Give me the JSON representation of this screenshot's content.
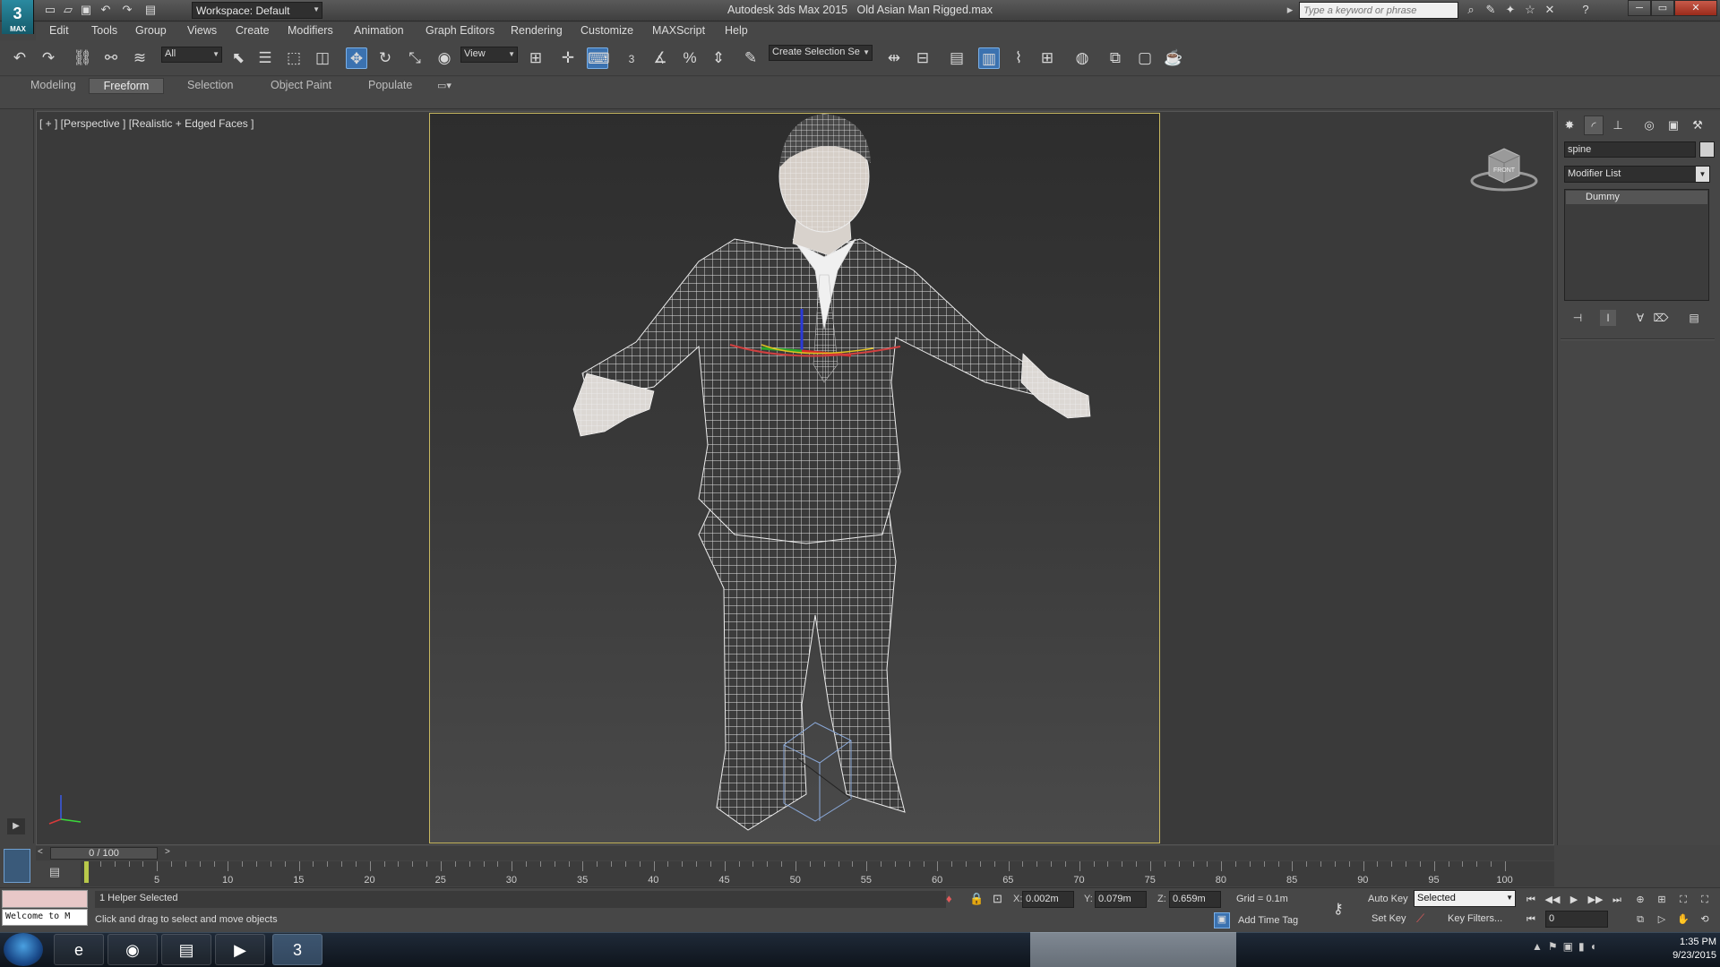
{
  "titlebar": {
    "app_name": "Autodesk 3ds Max  2015",
    "file_name": "Old Asian Man Rigged.max",
    "logo_text": "MAX",
    "workspace": "Workspace: Default",
    "search_placeholder": "Type a keyword or phrase"
  },
  "menu": [
    "Edit",
    "Tools",
    "Group",
    "Views",
    "Create",
    "Modifiers",
    "Animation",
    "Graph Editors",
    "Rendering",
    "Customize",
    "MAXScript",
    "Help"
  ],
  "toolbar": {
    "selection_filter": "All",
    "ref_coord": "View",
    "snap_label": "3",
    "named_selection": "Create Selection Se"
  },
  "ribbon": {
    "tabs": [
      "Modeling",
      "Freeform",
      "Selection",
      "Object Paint",
      "Populate"
    ],
    "active_tab": "Freeform"
  },
  "viewport": {
    "label": "[ + ] [Perspective ] [Realistic + Edged Faces ]",
    "viewcube_text": "FRONT"
  },
  "command_panel": {
    "object_name": "spine",
    "modifier_list": "Modifier List",
    "stack_item": "Dummy"
  },
  "timeline": {
    "frame_display": "0 / 100",
    "ticks": [
      5,
      10,
      15,
      20,
      25,
      30,
      35,
      40,
      45,
      50,
      55,
      60,
      65,
      70,
      75,
      80,
      85,
      90,
      95,
      100
    ]
  },
  "status": {
    "listener_text": "Welcome to M",
    "selection": "1 Helper Selected",
    "prompt": "Click and drag to select and move objects",
    "x_label": "X:",
    "x_value": "0.002m",
    "y_label": "Y:",
    "y_value": "0.079m",
    "z_label": "Z:",
    "z_value": "0.659m",
    "grid": "Grid = 0.1m",
    "add_time_tag": "Add Time Tag",
    "auto_key": "Auto Key",
    "set_key": "Set Key",
    "selected": "Selected",
    "key_filters": "Key Filters...",
    "frame": "0"
  },
  "taskbar": {
    "time": "1:35 PM",
    "date": "9/23/2015"
  },
  "colors": {
    "accent": "#3b72b0",
    "safe_frame": "#c8b860",
    "wireframe": "#e8e8e8"
  }
}
